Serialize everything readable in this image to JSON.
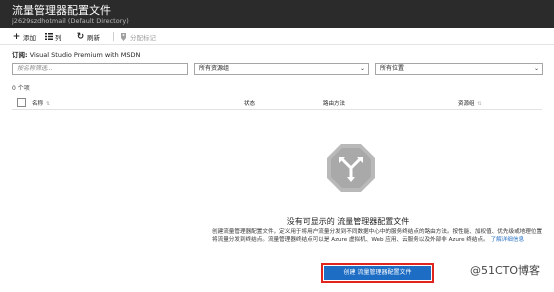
{
  "header": {
    "title": "流量管理器配置文件",
    "subtitle": "j2629szdhotmail (Default Directory)"
  },
  "toolbar": {
    "add": {
      "label": "添加",
      "icon": "plus-icon"
    },
    "columns": {
      "label": "列",
      "icon": "columns-icon"
    },
    "refresh": {
      "label": "刷新",
      "icon": "refresh-icon"
    },
    "assign_tags": {
      "label": "分配标记",
      "icon": "tag-icon"
    }
  },
  "subscription": {
    "label": "订阅:",
    "value": "Visual Studio Premium with MSDN"
  },
  "filters": {
    "search_placeholder": "按名称筛选...",
    "resource_group": "所有资源组",
    "location": "所有位置"
  },
  "item_count": "0 个项",
  "table": {
    "columns": [
      "名称",
      "状态",
      "路由方法",
      "资源组"
    ]
  },
  "empty_state": {
    "title": "没有可显示的 流量管理器配置文件",
    "description": "创建流量管理器配置文件，定义用于将用户流量分发到不同数据中心中的服务终结点的路由方法。按性能、加权值、优先级或地理位置将流量分发到终结点。流量管理器终结点可以是 Azure 虚拟机、Web 应用、云服务以及外部非 Azure 终结点。",
    "link_text": "了解详细信息",
    "create_button": "创建 流量管理器配置文件"
  },
  "watermark": "@51CTO博客"
}
